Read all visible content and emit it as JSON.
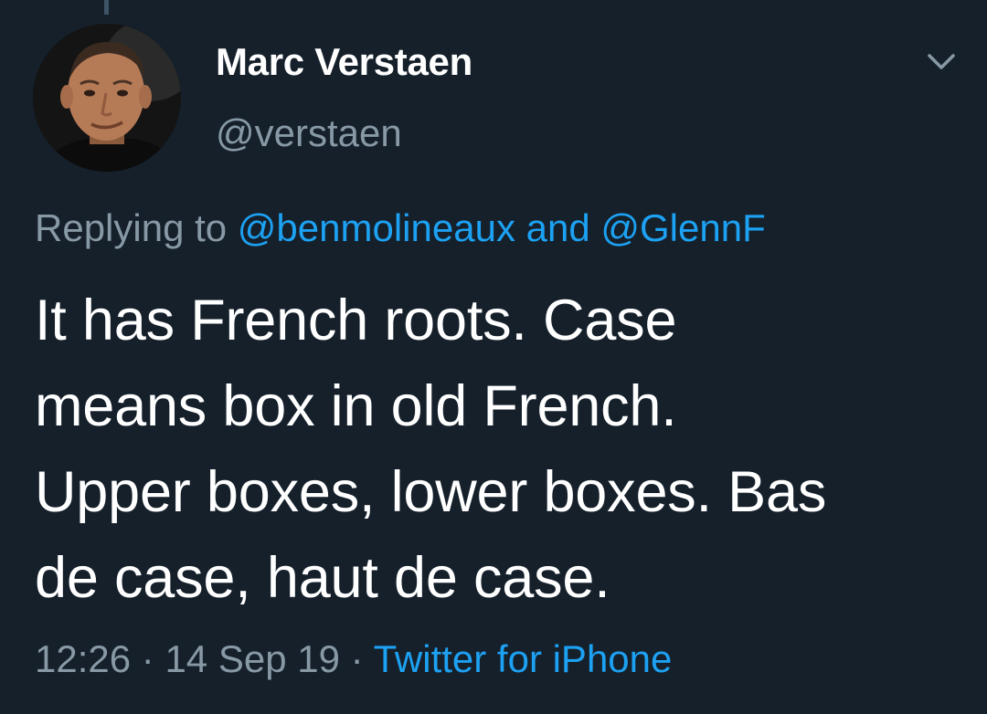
{
  "tweet": {
    "author": {
      "display_name": "Marc Verstaen",
      "handle": "@verstaen"
    },
    "reply_context": {
      "prefix": "Replying to",
      "mentions": [
        "@benmolineaux",
        "@GlennF"
      ],
      "joiner": "and"
    },
    "text_lines": [
      "It has French roots. Case",
      "means box in old French.",
      "Upper boxes, lower boxes. Bas",
      "de case, haut de case."
    ],
    "time": "12:26",
    "date": "14 Sep 19",
    "separator": "·",
    "source": "Twitter for iPhone"
  },
  "icons": {
    "menu": "chevron-down-icon"
  },
  "colors": {
    "background": "#15202b",
    "text": "#ffffff",
    "secondary_text": "#8899a6",
    "link": "#1da1f2"
  }
}
